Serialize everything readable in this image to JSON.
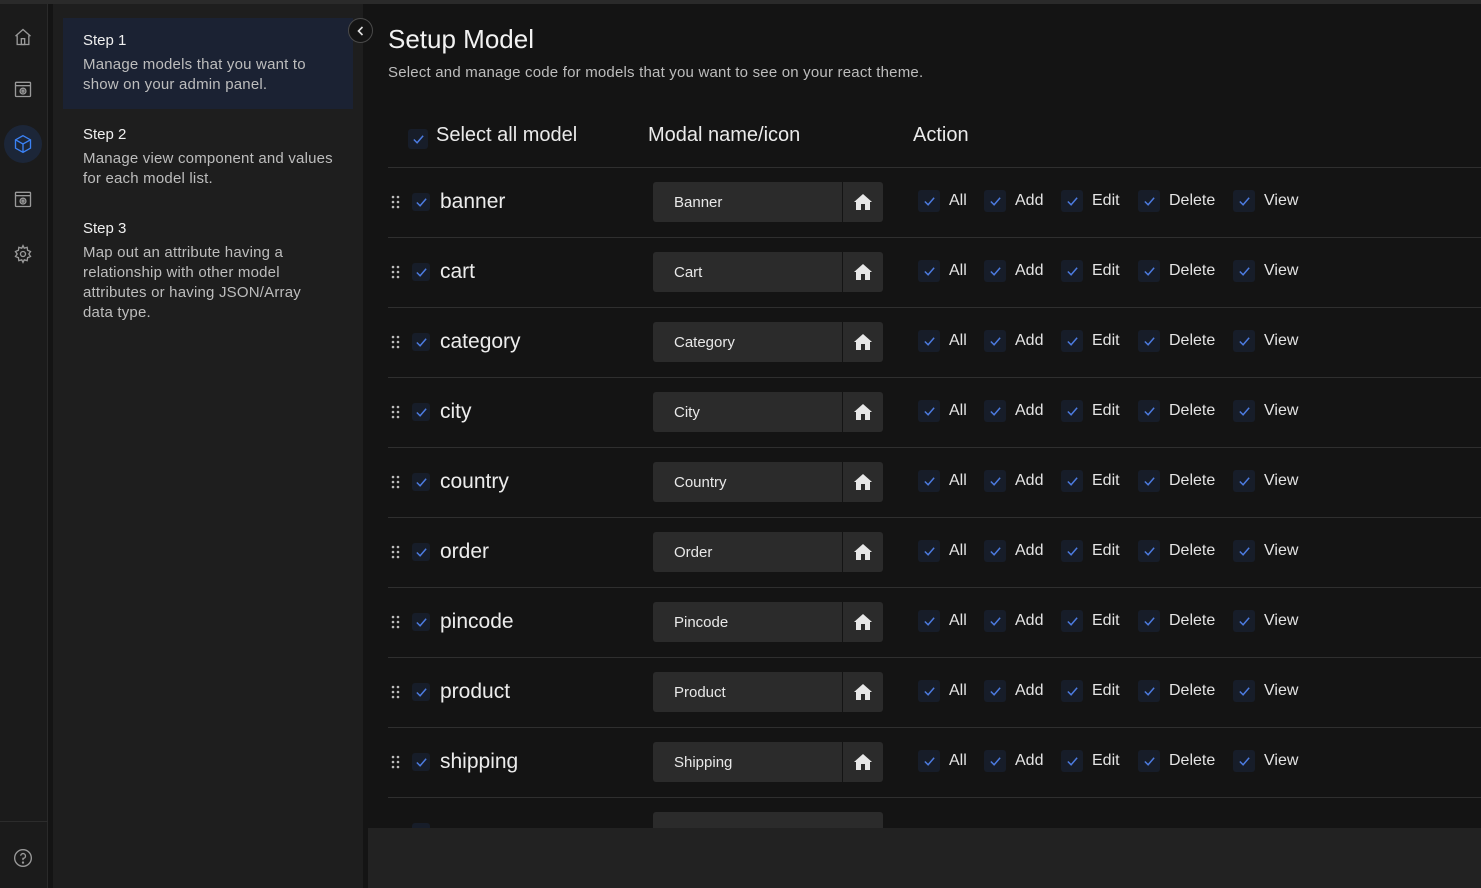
{
  "rail": {
    "icons": [
      "home-icon",
      "settings-box-icon",
      "model-cube-icon",
      "settings-box-2-icon",
      "gear-icon",
      "help-icon"
    ],
    "active_index": 2
  },
  "steps": [
    {
      "title": "Step 1",
      "desc": "Manage models that you want to show on your admin panel."
    },
    {
      "title": "Step 2",
      "desc": "Manage view component and values for each model list."
    },
    {
      "title": "Step 3",
      "desc": "Map out an attribute having a relationship with other model attributes or having JSON/Array data type."
    }
  ],
  "header": {
    "title": "Setup Model",
    "subtitle": "Select and manage code for models that you want to see on your react theme."
  },
  "table": {
    "select_all_label": "Select all model",
    "col_name": "Modal name/icon",
    "col_action": "Action",
    "perm_labels": {
      "all": "All",
      "add": "Add",
      "edit": "Edit",
      "delete": "Delete",
      "view": "View"
    },
    "rows": [
      {
        "model": "banner",
        "label": "Banner"
      },
      {
        "model": "cart",
        "label": "Cart"
      },
      {
        "model": "category",
        "label": "Category"
      },
      {
        "model": "city",
        "label": "City"
      },
      {
        "model": "country",
        "label": "Country"
      },
      {
        "model": "order",
        "label": "Order"
      },
      {
        "model": "pincode",
        "label": "Pincode"
      },
      {
        "model": "product",
        "label": "Product"
      },
      {
        "model": "shipping",
        "label": "Shipping"
      }
    ]
  },
  "colors": {
    "accent": "#3b82f6",
    "check": "#4c7be0",
    "input_bg": "#2b2b2b",
    "step_active_bg": "#1b2233"
  }
}
